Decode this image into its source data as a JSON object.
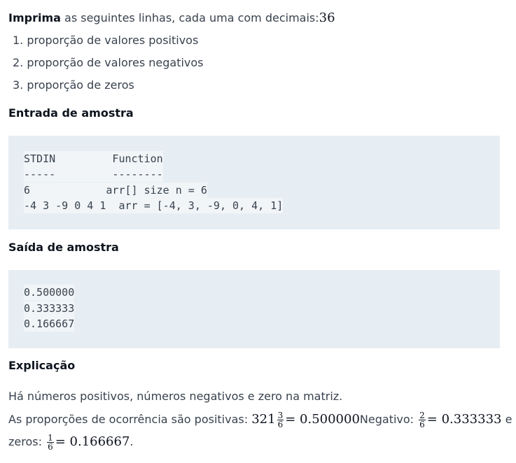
{
  "intro": {
    "bold": "Imprima",
    "text": " as seguintes linhas, cada uma com decimais:",
    "math": "36"
  },
  "list": [
    "1. proporção de valores positivos",
    "2. proporção de valores negativos",
    "3. proporção de zeros"
  ],
  "sample_input": {
    "heading": "Entrada de amostra",
    "lines": [
      "STDIN         Function",
      "-----         --------",
      "6            arr[] size n = 6",
      "-4 3 -9 0 4 1  arr = [-4, 3, -9, 0, 4, 1]"
    ]
  },
  "sample_output": {
    "heading": "Saída de amostra",
    "lines": [
      "0.500000",
      "0.333333",
      "0.166667"
    ]
  },
  "explanation": {
    "heading": "Explicação",
    "line1": "Há números positivos, números negativos e zero na matriz.",
    "line2_prefix": "As proporções de ocorrência são positivas: ",
    "pos_lead": "321",
    "pos_num": "3",
    "pos_den": "6",
    "pos_result": "= 0.500000",
    "neg_label": "Negativo: ",
    "neg_num": "2",
    "neg_den": "6",
    "neg_result": "= 0.333333",
    "conj": " e",
    "zeros_label": "zeros: ",
    "zero_num": "1",
    "zero_den": "6",
    "zero_result": "= 0.166667",
    "period": "."
  }
}
